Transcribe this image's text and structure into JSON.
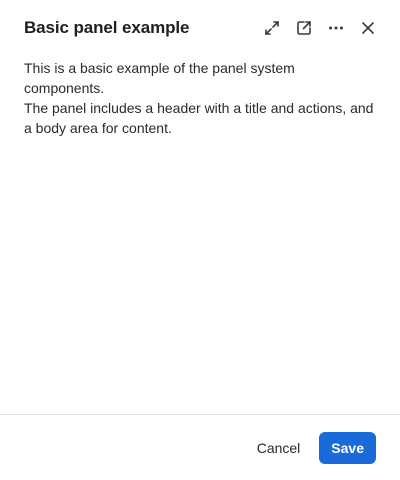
{
  "header": {
    "title": "Basic panel example",
    "actions": [
      {
        "name": "expand-icon"
      },
      {
        "name": "open-external-icon"
      },
      {
        "name": "more-options-icon"
      },
      {
        "name": "close-icon"
      }
    ]
  },
  "body": {
    "paragraph_1": "This is a basic example of the panel system components.",
    "paragraph_2": "The panel includes a header with a title and actions, and a body area for content."
  },
  "footer": {
    "cancel_label": "Cancel",
    "save_label": "Save"
  },
  "colors": {
    "primary": "#1a6ad9",
    "text": "#1f1f1f",
    "divider": "#e3e3e3",
    "icon": "#3a3a3a"
  }
}
